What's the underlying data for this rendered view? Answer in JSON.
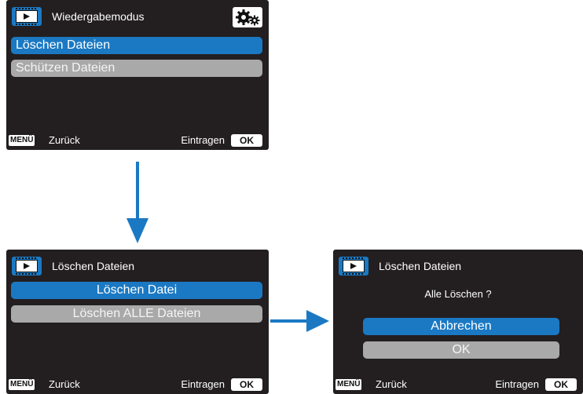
{
  "colors": {
    "accent": "#1b79c3",
    "screen_bg": "#231f20",
    "disabled": "#a9a9a9"
  },
  "screen1": {
    "mode_icon": "playback-icon",
    "settings_icon": "gears-icon",
    "title": "Wiedergabemodus",
    "items": [
      "Löschen Dateien",
      "Schützen Dateien"
    ],
    "selected_index": 0,
    "footer": {
      "menu_badge": "MENÜ",
      "back_label": "Zurück",
      "enter_label": "Eintragen",
      "ok_badge": "OK"
    }
  },
  "screen2": {
    "mode_icon": "playback-icon",
    "title": "Löschen Dateien",
    "items": [
      "Löschen Datei",
      "Löschen ALLE Dateien"
    ],
    "selected_index": 0,
    "footer": {
      "menu_badge": "MENÜ",
      "back_label": "Zurück",
      "enter_label": "Eintragen",
      "ok_badge": "OK"
    }
  },
  "screen3": {
    "mode_icon": "playback-icon",
    "title": "Löschen Dateien",
    "prompt": "Alle Löschen ?",
    "items": [
      "Abbrechen",
      "OK"
    ],
    "selected_index": 0,
    "footer": {
      "menu_badge": "MENÜ",
      "back_label": "Zurück",
      "enter_label": "Eintragen",
      "ok_badge": "OK"
    }
  },
  "arrows": [
    "arrow-down-icon",
    "arrow-right-icon"
  ]
}
